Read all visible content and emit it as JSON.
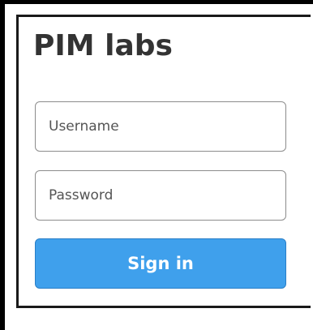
{
  "brand": {
    "title": "PIM labs"
  },
  "login": {
    "username_placeholder": "Username",
    "password_placeholder": "Password",
    "signin_label": "Sign in"
  },
  "colors": {
    "primary_button": "#3fa0ec",
    "button_text": "#ffffff",
    "title_text": "#333333"
  }
}
